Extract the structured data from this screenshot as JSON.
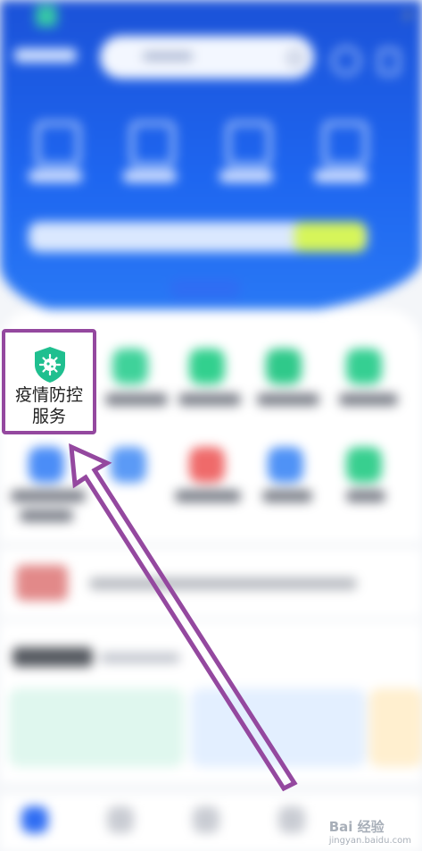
{
  "colors": {
    "banner_blue": "#1e66f0",
    "highlight_purple": "#94489f",
    "shield_green": "#1fbf8f",
    "slogan_yellow": "#d6f55a"
  },
  "focus_tile": {
    "label": "疫情防控\n服务",
    "icon": "virus-shield-icon"
  },
  "annotation": {
    "shape": "arrow",
    "color": "#94489f"
  },
  "watermark": {
    "brand": "Bai 经验",
    "url": "jingyan.baidu.com"
  }
}
